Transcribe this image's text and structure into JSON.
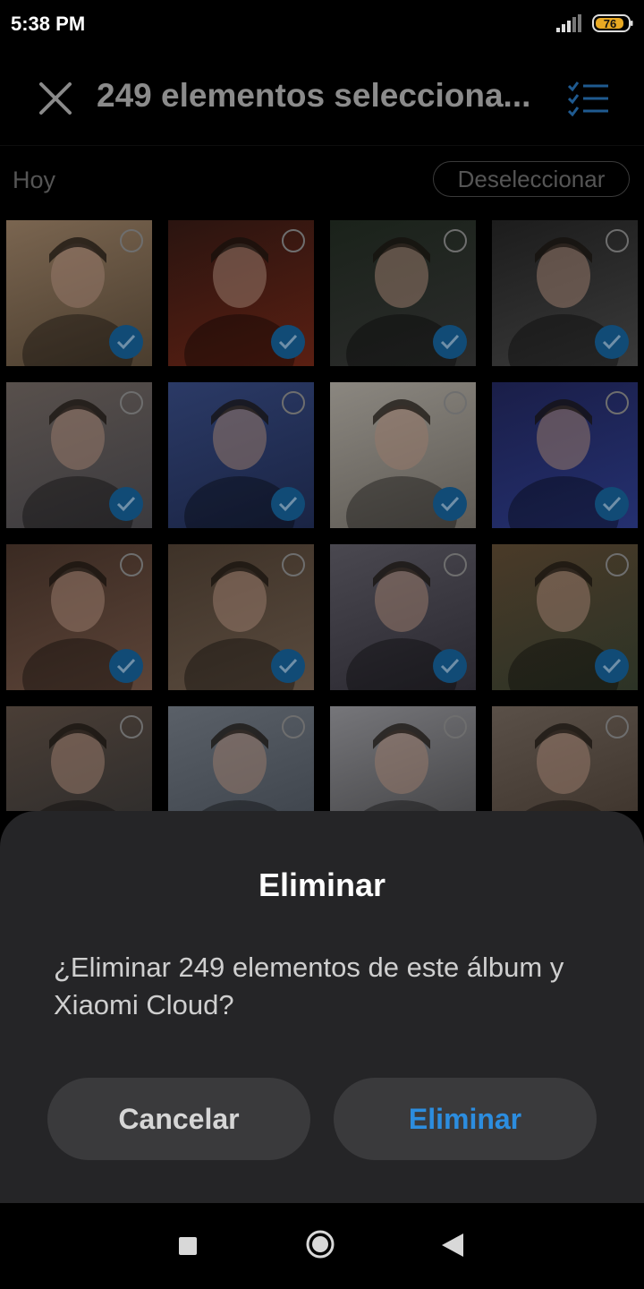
{
  "status_bar": {
    "time": "5:38 PM",
    "battery_level": "76",
    "icons": [
      "signal-icon",
      "battery-icon"
    ]
  },
  "header": {
    "title": "249 elementos selecciona...",
    "icons": [
      "close-icon",
      "select-all-icon"
    ]
  },
  "gallery": {
    "date_label": "Hoy",
    "deselect_label": "Deseleccionar",
    "tiles": [
      {
        "selected": true
      },
      {
        "selected": true
      },
      {
        "selected": true
      },
      {
        "selected": true
      },
      {
        "selected": true
      },
      {
        "selected": true
      },
      {
        "selected": true
      },
      {
        "selected": true
      },
      {
        "selected": true
      },
      {
        "selected": true
      },
      {
        "selected": true
      },
      {
        "selected": true
      },
      {
        "selected": true
      },
      {
        "selected": true
      },
      {
        "selected": true
      },
      {
        "selected": true
      }
    ]
  },
  "dialog": {
    "title": "Eliminar",
    "message": "¿Eliminar 249 elementos de este álbum y Xiaomi Cloud?",
    "cancel_label": "Cancelar",
    "confirm_label": "Eliminar"
  },
  "nav_bar": {
    "icons": [
      "recents-icon",
      "home-icon",
      "back-icon"
    ]
  },
  "colors": {
    "accent": "#2c8ddf",
    "sheet": "#252527",
    "button": "#3a3a3c",
    "check": "#114b76"
  }
}
